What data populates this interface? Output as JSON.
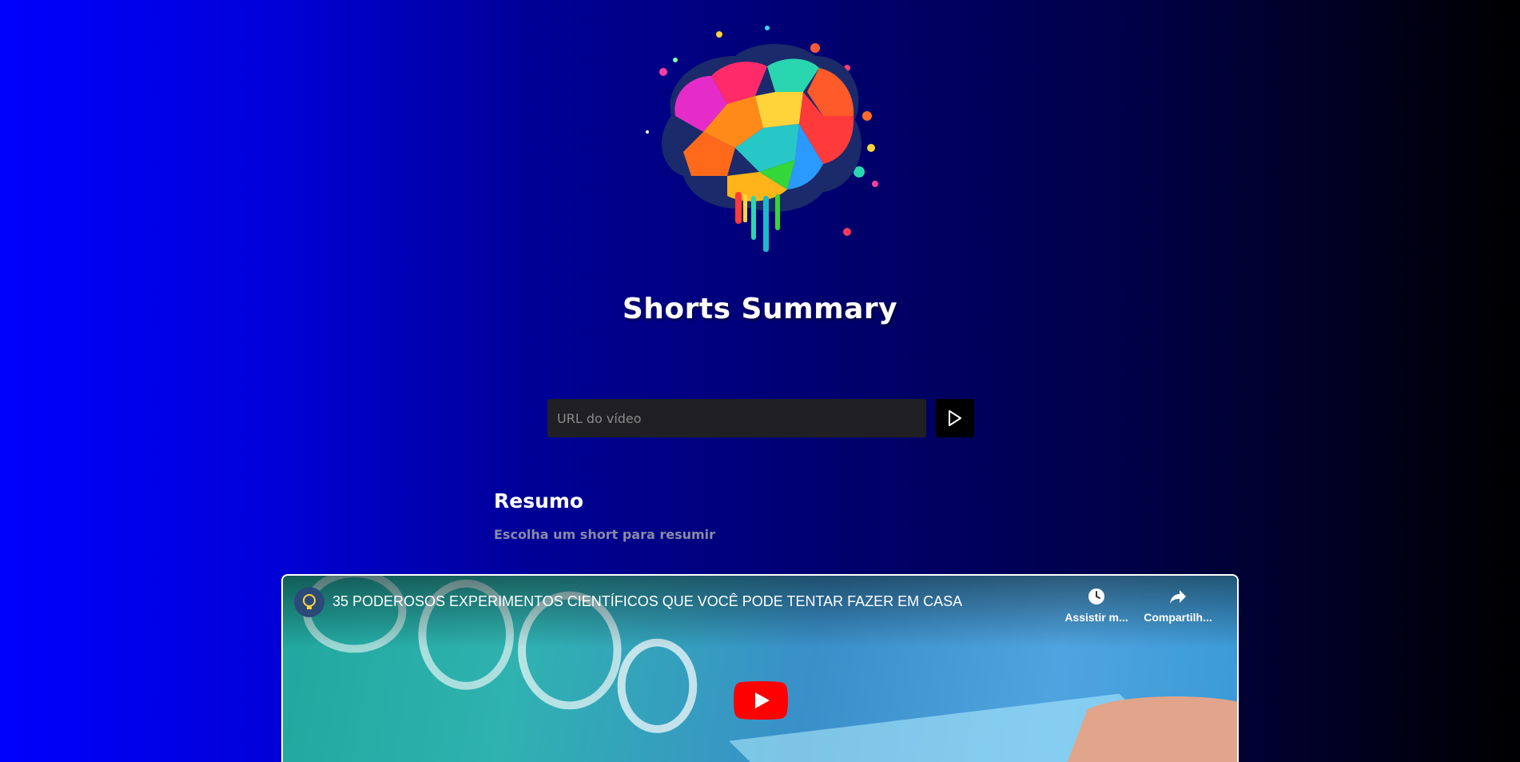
{
  "app": {
    "title": "Shorts Summary"
  },
  "search": {
    "placeholder": "URL do vídeo",
    "value": ""
  },
  "summary": {
    "heading": "Resumo",
    "text": "Escolha um short para resumir"
  },
  "video": {
    "title": "35 PODEROSOS EXPERIMENTOS CIENTÍFICOS QUE VOCÊ PODE TENTAR FAZER EM CASA",
    "watch_later_label": "Assistir m...",
    "share_label": "Compartilh...",
    "icons": {
      "watch_later": "clock-icon",
      "share": "share-arrow-icon",
      "play": "youtube-play-icon"
    }
  },
  "colors": {
    "background_left": "#0000fe",
    "background_right": "#000000",
    "input_bg": "#202024",
    "youtube_red": "#ff0000"
  }
}
